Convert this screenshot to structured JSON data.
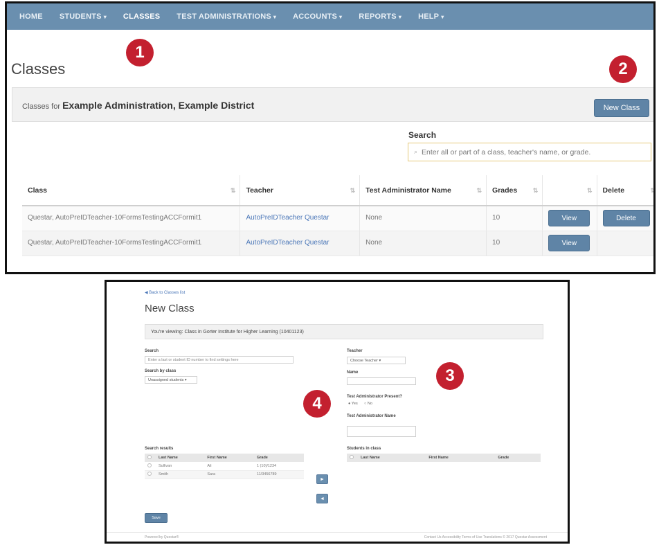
{
  "nav": {
    "items": [
      {
        "label": "HOME",
        "caret": ""
      },
      {
        "label": "STUDENTS",
        "caret": "▾"
      },
      {
        "label": "CLASSES",
        "caret": ""
      },
      {
        "label": "TEST ADMINISTRATIONS",
        "caret": "▾"
      },
      {
        "label": "ACCOUNTS",
        "caret": "▾"
      },
      {
        "label": "REPORTS",
        "caret": "▾"
      },
      {
        "label": "HELP",
        "caret": "▾"
      }
    ],
    "colors": {
      "bar": "#6a8faf"
    }
  },
  "page": {
    "title": "Classes",
    "subhead_prefix": "Classes for",
    "subhead_bold": "Example Administration, Example District",
    "new_class_label": "New Class"
  },
  "search": {
    "label": "Search",
    "placeholder": "Enter all or part of a class, teacher's name, or grade."
  },
  "table": {
    "headers": [
      "Class",
      "Teacher",
      "Test Administrator Name",
      "Grades",
      "",
      "Delete"
    ],
    "rows": [
      {
        "class": "Questar, AutoPreIDTeacher-10FormsTestingACCFormit1",
        "teacher": "AutoPreIDTeacher Questar",
        "admin": "None",
        "grades": "10",
        "view": "View",
        "delete": "Delete"
      },
      {
        "class": "Questar, AutoPreIDTeacher-10FormsTestingACCFormit1",
        "teacher": "AutoPreIDTeacher Questar",
        "admin": "None",
        "grades": "10",
        "view": "View",
        "delete": ""
      }
    ]
  },
  "callouts": [
    "1",
    "2",
    "3",
    "4"
  ],
  "new_class": {
    "back_link": "◀ Back to Classes list",
    "title": "New Class",
    "bar_text": "You're viewing: Class in Gorter Institute for Higher Learning (10401123)",
    "search_label": "Search",
    "search_placeholder": "Enter a last or student ID number to find settings here",
    "search_by_label": "Search by class",
    "search_by_value": "Unassigned students ▾",
    "teacher_label": "Teacher",
    "teacher_value": "Choose Teacher ▾",
    "name_label": "Name",
    "admin_present_label": "Test Administrator Present?",
    "radio_yes": "● Yes",
    "radio_no": "○ No",
    "admin_name_label": "Test Administrator Name",
    "results_label": "Search results",
    "results_headers": [
      "",
      "Last Name",
      "First Name",
      "Grade"
    ],
    "results_rows": [
      [
        "",
        "Sullivan",
        "Ali",
        "1 (10)/1234"
      ],
      [
        "",
        "Smith",
        "Sara",
        "11/3456789"
      ]
    ],
    "roster_label": "Students in class",
    "roster_headers": [
      "",
      "Last Name",
      "First Name",
      "Grade"
    ],
    "save_label": "Save",
    "footer_left": "Powered by Questar®",
    "footer_right": "Contact Us   Accessibility   Terms of Use   Translations   © 2017 Questar Assessment"
  }
}
